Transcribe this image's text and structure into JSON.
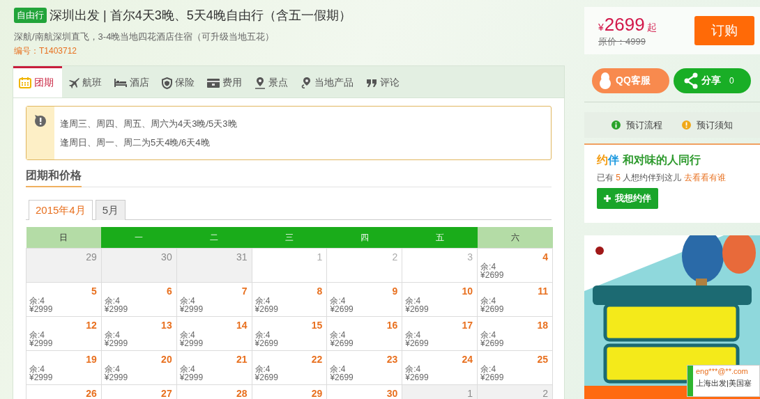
{
  "header": {
    "tag": "自由行",
    "title": "深圳出发 | 首尔4天3晚、5天4晚自由行（含五一假期）",
    "subtitle": "深航/南航深圳直飞，3-4晚当地四花酒店住宿（可升级当地五花）",
    "code": "编号：T1403712"
  },
  "price": {
    "currency": "¥",
    "amount": "2699",
    "suffix": "起",
    "original": "原价：4999",
    "button": "订购"
  },
  "tabs": [
    {
      "label": "团期",
      "selected": true
    },
    {
      "label": "航班",
      "selected": false
    },
    {
      "label": "酒店",
      "selected": false
    },
    {
      "label": "保险",
      "selected": false
    },
    {
      "label": "费用",
      "selected": false
    },
    {
      "label": "景点",
      "selected": false
    },
    {
      "label": "当地产品",
      "selected": false
    },
    {
      "label": "评论",
      "selected": false
    }
  ],
  "notice": [
    "逢周三、周四、周五、周六为4天3晚/5天3晚",
    "逢周日、周一、周二为5天4晚/6天4晚"
  ],
  "section_title": "团期和价格",
  "month_tabs": [
    {
      "label": "2015年4月",
      "selected": true
    },
    {
      "label": "5月",
      "selected": false
    }
  ],
  "calendar": {
    "weekdays": [
      {
        "label": "日",
        "weekend": true
      },
      {
        "label": "一",
        "weekend": false
      },
      {
        "label": "二",
        "weekend": false
      },
      {
        "label": "三",
        "weekend": false
      },
      {
        "label": "四",
        "weekend": false
      },
      {
        "label": "五",
        "weekend": false
      },
      {
        "label": "六",
        "weekend": true
      }
    ],
    "weeks": [
      [
        {
          "day": "29",
          "kind": "other"
        },
        {
          "day": "30",
          "kind": "other"
        },
        {
          "day": "31",
          "kind": "other"
        },
        {
          "day": "1",
          "kind": "closed"
        },
        {
          "day": "2",
          "kind": "closed"
        },
        {
          "day": "3",
          "kind": "closed"
        },
        {
          "day": "4",
          "kind": "open",
          "remain": "余:4",
          "price": "¥2699"
        }
      ],
      [
        {
          "day": "5",
          "kind": "open",
          "remain": "余:4",
          "price": "¥2999"
        },
        {
          "day": "6",
          "kind": "open",
          "remain": "余:4",
          "price": "¥2999"
        },
        {
          "day": "7",
          "kind": "open",
          "remain": "余:4",
          "price": "¥2999"
        },
        {
          "day": "8",
          "kind": "open",
          "remain": "余:4",
          "price": "¥2699"
        },
        {
          "day": "9",
          "kind": "open",
          "remain": "余:4",
          "price": "¥2699"
        },
        {
          "day": "10",
          "kind": "open",
          "remain": "余:4",
          "price": "¥2699"
        },
        {
          "day": "11",
          "kind": "open",
          "remain": "余:4",
          "price": "¥2699"
        }
      ],
      [
        {
          "day": "12",
          "kind": "open",
          "remain": "余:4",
          "price": "¥2999"
        },
        {
          "day": "13",
          "kind": "open",
          "remain": "余:4",
          "price": "¥2999"
        },
        {
          "day": "14",
          "kind": "open",
          "remain": "余:4",
          "price": "¥2999"
        },
        {
          "day": "15",
          "kind": "open",
          "remain": "余:4",
          "price": "¥2699"
        },
        {
          "day": "16",
          "kind": "open",
          "remain": "余:4",
          "price": "¥2699"
        },
        {
          "day": "17",
          "kind": "open",
          "remain": "余:4",
          "price": "¥2699"
        },
        {
          "day": "18",
          "kind": "open",
          "remain": "余:4",
          "price": "¥2699"
        }
      ],
      [
        {
          "day": "19",
          "kind": "open",
          "remain": "余:4",
          "price": "¥2999"
        },
        {
          "day": "20",
          "kind": "open",
          "remain": "余:4",
          "price": "¥2999"
        },
        {
          "day": "21",
          "kind": "open",
          "remain": "余:4",
          "price": "¥2999"
        },
        {
          "day": "22",
          "kind": "open",
          "remain": "余:4",
          "price": "¥2699"
        },
        {
          "day": "23",
          "kind": "open",
          "remain": "余:4",
          "price": "¥2699"
        },
        {
          "day": "24",
          "kind": "open",
          "remain": "余:4",
          "price": "¥2699"
        },
        {
          "day": "25",
          "kind": "open",
          "remain": "余:4",
          "price": "¥2699"
        }
      ],
      [
        {
          "day": "26",
          "kind": "open"
        },
        {
          "day": "27",
          "kind": "open"
        },
        {
          "day": "28",
          "kind": "open"
        },
        {
          "day": "29",
          "kind": "open"
        },
        {
          "day": "30",
          "kind": "open"
        },
        {
          "day": "1",
          "kind": "other"
        },
        {
          "day": "2",
          "kind": "other"
        }
      ]
    ]
  },
  "service": {
    "qq": "QQ客服",
    "share": "分享",
    "share_count": "0"
  },
  "links": [
    {
      "label": "预订流程",
      "kind": "info"
    },
    {
      "label": "预订须知",
      "kind": "warn"
    }
  ],
  "companion": {
    "logo_a": "约",
    "logo_b": "伴",
    "title": "和对味的人同行",
    "text_a": "已有",
    "count": "5",
    "text_b": "人想约伴到这儿",
    "link": "去看看有谁",
    "button": "我想约伴"
  },
  "popup": {
    "user": "eng***@**.com",
    "text": "上海出发|美国塞"
  }
}
